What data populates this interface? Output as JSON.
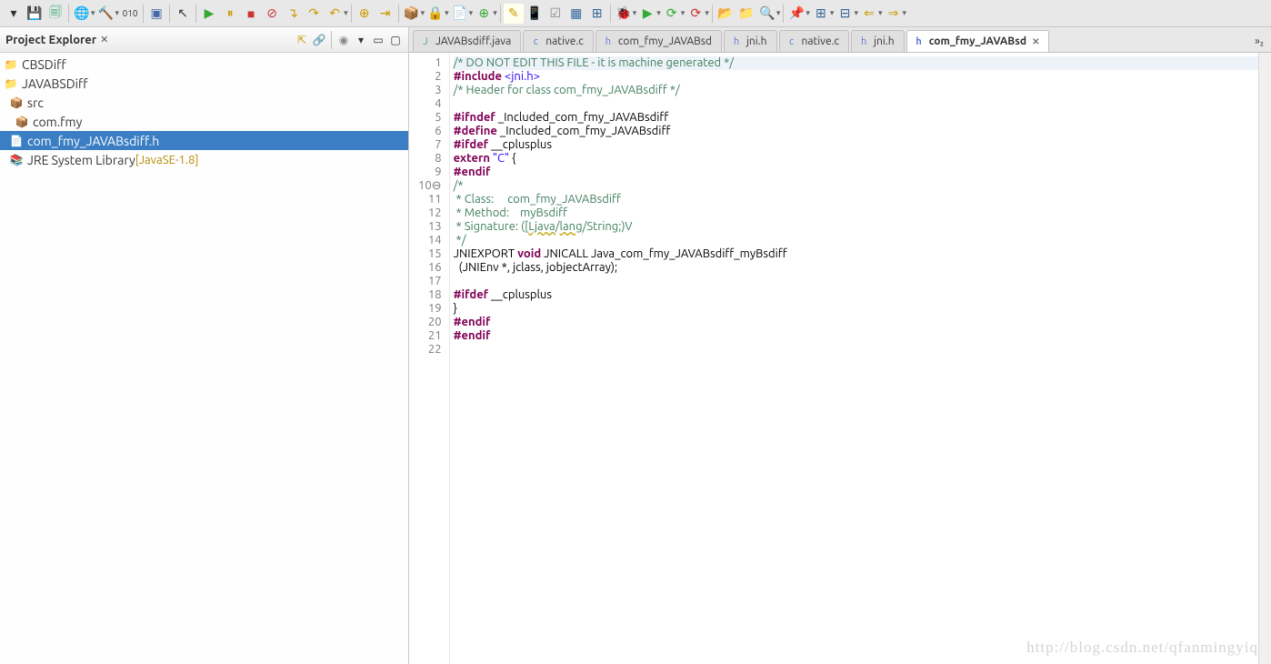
{
  "toolbar": {
    "save": "💾",
    "saveall": "🗐"
  },
  "explorer": {
    "title": "Project Explorer",
    "items": [
      {
        "pad": 0,
        "icon": "📁",
        "label": "CBSDiff"
      },
      {
        "pad": 0,
        "icon": "📁",
        "label": "JAVABSDiff"
      },
      {
        "pad": 6,
        "icon": "📦",
        "label": "src"
      },
      {
        "pad": 12,
        "icon": "📦",
        "label": "com.fmy"
      },
      {
        "pad": 6,
        "icon": "📄",
        "label": "com_fmy_JAVABsdiff.h",
        "selected": true
      },
      {
        "pad": 6,
        "icon": "📚",
        "label": "JRE System Library",
        "decor": " [JavaSE-1.8]"
      }
    ]
  },
  "tabs": [
    {
      "icon": "J",
      "label": "JAVABsdiff.java",
      "color": "#4a6"
    },
    {
      "icon": "c",
      "label": "native.c",
      "color": "#57c"
    },
    {
      "icon": "h",
      "label": "com_fmy_JAVABsd",
      "color": "#57c"
    },
    {
      "icon": "h",
      "label": "jni.h",
      "color": "#57c"
    },
    {
      "icon": "c",
      "label": "native.c",
      "color": "#57c"
    },
    {
      "icon": "h",
      "label": "jni.h",
      "color": "#57c"
    },
    {
      "icon": "h",
      "label": "com_fmy_JAVABsd",
      "color": "#57c",
      "active": true,
      "close": true
    }
  ],
  "more_tabs": "»₂",
  "code": [
    {
      "n": 1,
      "hl": true,
      "tokens": [
        {
          "t": "/* DO NOT EDIT THIS FILE - it is machine generated */",
          "c": "c-comment"
        }
      ]
    },
    {
      "n": 2,
      "tokens": [
        {
          "t": "#include",
          "c": "c-keyword"
        },
        {
          "t": " "
        },
        {
          "t": "<jni.h>",
          "c": "c-include"
        }
      ]
    },
    {
      "n": 3,
      "tokens": [
        {
          "t": "/* Header for class com_fmy_JAVABsdiff */",
          "c": "c-comment"
        }
      ]
    },
    {
      "n": 4,
      "tokens": []
    },
    {
      "n": 5,
      "tokens": [
        {
          "t": "#ifndef",
          "c": "c-keyword"
        },
        {
          "t": " _Included_com_fmy_JAVABsdiff"
        }
      ]
    },
    {
      "n": 6,
      "tokens": [
        {
          "t": "#define",
          "c": "c-keyword"
        },
        {
          "t": " _Included_com_fmy_JAVABsdiff"
        }
      ]
    },
    {
      "n": 7,
      "tokens": [
        {
          "t": "#ifdef",
          "c": "c-keyword"
        },
        {
          "t": " __cplusplus"
        }
      ]
    },
    {
      "n": 8,
      "tokens": [
        {
          "t": "extern",
          "c": "c-keyword"
        },
        {
          "t": " "
        },
        {
          "t": "\"C\"",
          "c": "c-string"
        },
        {
          "t": " {"
        }
      ]
    },
    {
      "n": 9,
      "tokens": [
        {
          "t": "#endif",
          "c": "c-keyword"
        }
      ]
    },
    {
      "n": 10,
      "fold": true,
      "tokens": [
        {
          "t": "/*",
          "c": "c-comment"
        }
      ]
    },
    {
      "n": 11,
      "tokens": [
        {
          "t": " * Class:     com_fmy_JAVABsdiff",
          "c": "c-comment"
        }
      ]
    },
    {
      "n": 12,
      "tokens": [
        {
          "t": " * Method:    myBsdiff",
          "c": "c-comment"
        }
      ]
    },
    {
      "n": 13,
      "tokens": [
        {
          "t": " * Signature: ([",
          "c": "c-comment"
        },
        {
          "t": "Ljava",
          "c": "c-comment c-underline"
        },
        {
          "t": "/",
          "c": "c-comment"
        },
        {
          "t": "lang",
          "c": "c-comment c-underline"
        },
        {
          "t": "/String;)V",
          "c": "c-comment"
        }
      ]
    },
    {
      "n": 14,
      "tokens": [
        {
          "t": " */",
          "c": "c-comment"
        }
      ]
    },
    {
      "n": 15,
      "tokens": [
        {
          "t": "JNIEXPORT "
        },
        {
          "t": "void",
          "c": "c-keyword"
        },
        {
          "t": " JNICALL Java_com_fmy_JAVABsdiff_myBsdiff"
        }
      ]
    },
    {
      "n": 16,
      "tokens": [
        {
          "t": "  (JNIEnv *, jclass, jobjectArray);"
        }
      ]
    },
    {
      "n": 17,
      "tokens": []
    },
    {
      "n": 18,
      "tokens": [
        {
          "t": "#ifdef",
          "c": "c-keyword"
        },
        {
          "t": " __cplusplus"
        }
      ]
    },
    {
      "n": 19,
      "tokens": [
        {
          "t": "}"
        }
      ]
    },
    {
      "n": 20,
      "tokens": [
        {
          "t": "#endif",
          "c": "c-keyword"
        }
      ]
    },
    {
      "n": 21,
      "tokens": [
        {
          "t": "#endif",
          "c": "c-keyword"
        }
      ]
    },
    {
      "n": 22,
      "tokens": []
    }
  ],
  "watermark": "http://blog.csdn.net/qfanmingyiq"
}
